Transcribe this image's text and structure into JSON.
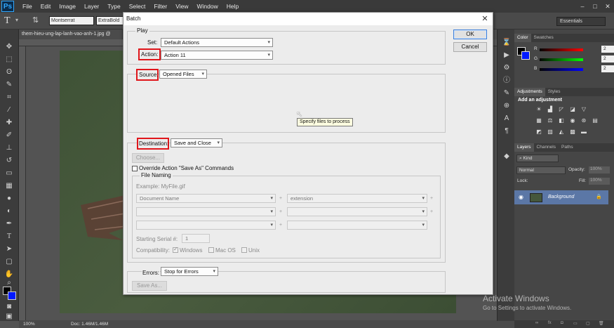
{
  "app": {
    "logo": "Ps",
    "menu": [
      "File",
      "Edit",
      "Image",
      "Layer",
      "Type",
      "Select",
      "Filter",
      "View",
      "Window",
      "Help"
    ],
    "workspace": "Essentials"
  },
  "options": {
    "font": "Montserrat",
    "style": "ExtraBold"
  },
  "document": {
    "tab": "them-hieu-ung-lap-lanh-vao-anh-1.jpg @",
    "zoom": "100%",
    "doc_size": "Doc: 1.46M/1.46M"
  },
  "panels": {
    "color_tabs": [
      "Color",
      "Swatches"
    ],
    "color_values": {
      "r_label": "R",
      "g_label": "G",
      "b_label": "B",
      "r": "2",
      "g": "2",
      "b": "2"
    },
    "adjust_tabs": [
      "Adjustments",
      "Styles"
    ],
    "adjust_heading": "Add an adjustment",
    "layer_tabs": [
      "Layers",
      "Channels",
      "Paths"
    ],
    "kind_label": "Kind",
    "blend_mode": "Normal",
    "opacity_label": "Opacity:",
    "opacity": "100%",
    "lock_label": "Lock:",
    "fill_label": "Fill:",
    "fill": "100%",
    "layer_name": "Background"
  },
  "watermark": {
    "title": "Activate Windows",
    "subtitle": "Go to Settings to activate Windows."
  },
  "dialog": {
    "title": "Batch",
    "close": "✕",
    "ok": "OK",
    "cancel": "Cancel",
    "play": {
      "group": "Play",
      "set_label": "Set:",
      "set_value": "Default Actions",
      "action_label": "Action:",
      "action_value": "Action 11"
    },
    "source": {
      "label": "Source:",
      "value": "Opened Files",
      "tooltip": "Specify files to process"
    },
    "destination": {
      "label": "Destination:",
      "value": "Save and Close",
      "choose": "Choose...",
      "override": "Override Action \"Save As\" Commands",
      "file_naming": "File Naming",
      "example": "Example: MyFile.gif",
      "name1": "Document Name",
      "name2": "extension",
      "plus": "+",
      "serial_label": "Starting Serial #:",
      "serial_value": "1",
      "compat_label": "Compatibility:",
      "compat_windows": "Windows",
      "compat_mac": "Mac OS",
      "compat_unix": "Unix"
    },
    "errors": {
      "label": "Errors:",
      "value": "Stop for Errors",
      "save_as": "Save As..."
    }
  }
}
